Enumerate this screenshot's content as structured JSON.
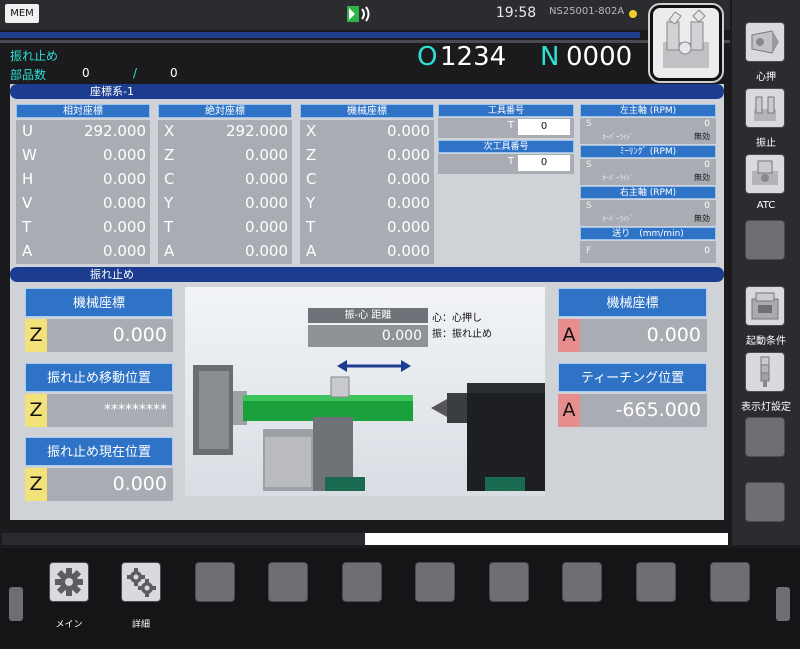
{
  "top": {
    "mode": "MEM",
    "time": "19:58",
    "model": "NS25001-802A"
  },
  "header": {
    "status": "振れ止め",
    "parts_label": "部品数",
    "parts_count": "0",
    "parts_separator": "/",
    "parts_total": "0",
    "program_letter": "O",
    "program_number": "1234",
    "seq_letter": "N",
    "seq_number": "0000"
  },
  "coord_section": {
    "title": "座標系-1",
    "columns": [
      {
        "title": "相対座標",
        "rows": [
          {
            "axis": "U",
            "value": "292.000"
          },
          {
            "axis": "W",
            "value": "0.000"
          },
          {
            "axis": "H",
            "value": "0.000"
          },
          {
            "axis": "V",
            "value": "0.000"
          },
          {
            "axis": "T",
            "value": "0.000"
          },
          {
            "axis": "A",
            "value": "0.000"
          }
        ]
      },
      {
        "title": "絶対座標",
        "rows": [
          {
            "axis": "X",
            "value": "292.000"
          },
          {
            "axis": "Z",
            "value": "0.000"
          },
          {
            "axis": "C",
            "value": "0.000"
          },
          {
            "axis": "Y",
            "value": "0.000"
          },
          {
            "axis": "T",
            "value": "0.000"
          },
          {
            "axis": "A",
            "value": "0.000"
          }
        ]
      },
      {
        "title": "機械座標",
        "rows": [
          {
            "axis": "X",
            "value": "0.000"
          },
          {
            "axis": "Z",
            "value": "0.000"
          },
          {
            "axis": "C",
            "value": "0.000"
          },
          {
            "axis": "Y",
            "value": "0.000"
          },
          {
            "axis": "T",
            "value": "0.000"
          },
          {
            "axis": "A",
            "value": "0.000"
          }
        ]
      }
    ],
    "tool": {
      "title": "工具番号",
      "letter": "T",
      "value": "0"
    },
    "next_tool": {
      "title": "次工具番号",
      "letter": "T",
      "value": "0"
    },
    "spindles": [
      {
        "title": "左主軸 (RPM)",
        "s_label": "S",
        "s_value": "0",
        "ov_label": "ｵｰﾊﾞｰﾗｲﾄﾞ",
        "ov_value": "無効"
      },
      {
        "title": "ﾐｰﾘﾝｸﾞ (RPM)",
        "s_label": "S",
        "s_value": "0",
        "ov_label": "ｵｰﾊﾞｰﾗｲﾄﾞ",
        "ov_value": "無効"
      },
      {
        "title": "右主軸 (RPM)",
        "s_label": "S",
        "s_value": "0",
        "ov_label": "ｵｰﾊﾞｰﾗｲﾄﾞ",
        "ov_value": "無効"
      }
    ],
    "feed": {
      "title": "送り　(mm/min)",
      "label": "F",
      "value": "0"
    }
  },
  "steady_section": {
    "title": "振れ止め",
    "left_boxes": [
      {
        "title": "機械座標",
        "axis": "Z",
        "value": "0.000"
      },
      {
        "title": "振れ止め移動位置",
        "axis": "Z",
        "value": "*********"
      },
      {
        "title": "振れ止め現在位置",
        "axis": "Z",
        "value": "0.000"
      }
    ],
    "right_boxes": [
      {
        "title": "機械座標",
        "axis": "A",
        "value": "0.000"
      },
      {
        "title": "ティーチング位置",
        "axis": "A",
        "value": "-665.000"
      }
    ],
    "distance_title": "振-心 距離",
    "distance_value": "0.000",
    "legend_1": "心：心押し",
    "legend_2": "振：振れ止め"
  },
  "progress": 0.5,
  "side_buttons": [
    {
      "label": "心押"
    },
    {
      "label": "振止"
    },
    {
      "label": "ATC"
    },
    {
      "label": ""
    },
    {
      "label": "起動条件"
    },
    {
      "label": "表示灯設定"
    },
    {
      "label": ""
    },
    {
      "label": ""
    }
  ],
  "bottom_buttons": [
    {
      "label": "メイン"
    },
    {
      "label": "詳細"
    },
    {
      "label": ""
    },
    {
      "label": ""
    },
    {
      "label": ""
    },
    {
      "label": ""
    },
    {
      "label": ""
    },
    {
      "label": ""
    },
    {
      "label": ""
    },
    {
      "label": ""
    }
  ],
  "colors": {
    "accent_cyan": "#2ee0d4",
    "header_blue": "#1c3d8f",
    "button_blue": "#2f73c7",
    "axis_yellow": "#f3e27a",
    "axis_red": "#e88d8e"
  }
}
